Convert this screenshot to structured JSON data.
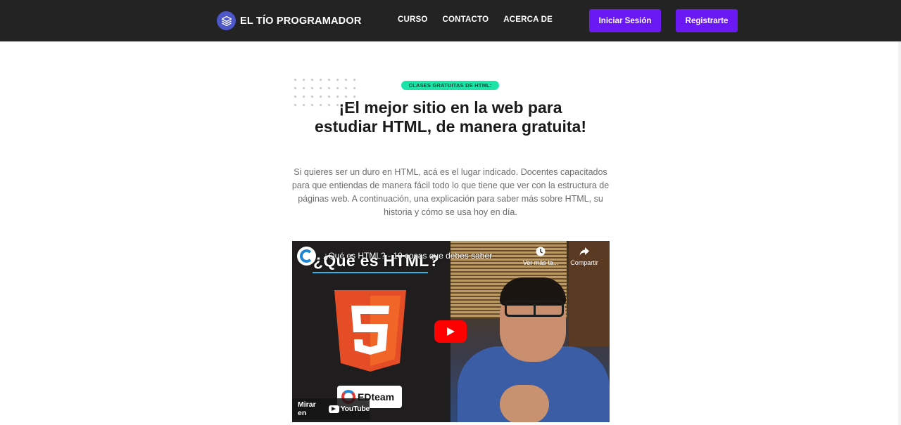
{
  "nav": {
    "brand": "EL TÍO PROGRAMADOR",
    "brand_icon": "layers-icon",
    "links": [
      "CURSO",
      "CONTACTO",
      "ACERCA DE"
    ],
    "login_label": "Iniciar Sesión",
    "register_label": "Registrarte",
    "accent_color": "#6a19f5"
  },
  "hero": {
    "badge": "CLASES GRATUITAS DE HTML:",
    "title": "¡El mejor sitio en la web para estudiar HTML, de manera gratuita!",
    "description": "Si quieres ser un duro en HTML, acá es el lugar indicado. Docentes capacitados para que entiendas de manera fácil todo lo que tiene que ver con la estructura de páginas web. A continuación, una explicación para saber más sobre HTML, su historia y cómo se usa hoy en día.",
    "badge_color": "#1ee3a8"
  },
  "video": {
    "title": "¿Qué es HTML? - 10 cosas que debes saber",
    "overlay_heading": "¿Qué es HTML?",
    "brand_text": "EDteam",
    "html5_number": "5",
    "watch_later": "Ver más ta...",
    "share": "Compartir",
    "watch_on": "Mirar en",
    "youtube": "YouTube"
  }
}
